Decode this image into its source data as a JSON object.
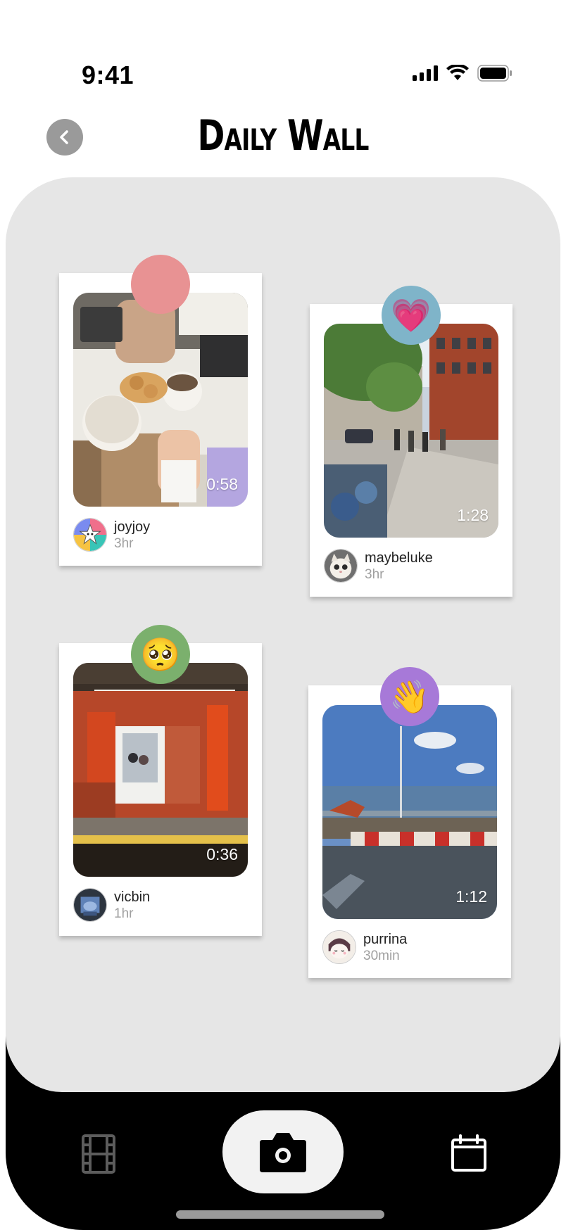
{
  "status_bar": {
    "time": "9:41",
    "icons": [
      "cellular-signal-icon",
      "wifi-icon",
      "battery-icon"
    ]
  },
  "header": {
    "title": "Daily Wall",
    "back_icon": "chevron-left-icon"
  },
  "posts": [
    {
      "username": "joyjoy",
      "ago": "3hr",
      "duration": "0:58",
      "reaction": "",
      "reaction_color": "#e89293",
      "photo": "cafe table with coffee cups and pastries"
    },
    {
      "username": "maybeluke",
      "ago": "3hr",
      "duration": "1:28",
      "reaction": "💗",
      "reaction_color": "#7fb4c9",
      "photo": "city street sidewalk with bike share"
    },
    {
      "username": "vicbin",
      "ago": "1hr",
      "duration": "0:36",
      "reaction": "🥺",
      "reaction_color": "#7bb06d",
      "photo": "subway station platform with red tiles"
    },
    {
      "username": "purrina",
      "ago": "30min",
      "duration": "1:12",
      "reaction": "👋",
      "reaction_color": "#a779d8",
      "photo": "lakefront construction view"
    }
  ],
  "nav": {
    "left_icon": "film-strip-icon",
    "center_icon": "camera-icon",
    "right_icon": "calendar-icon"
  },
  "colors": {
    "wall": "#e6e6e6",
    "device_bottom": "#000000",
    "camera_button": "#f2f2f2"
  }
}
